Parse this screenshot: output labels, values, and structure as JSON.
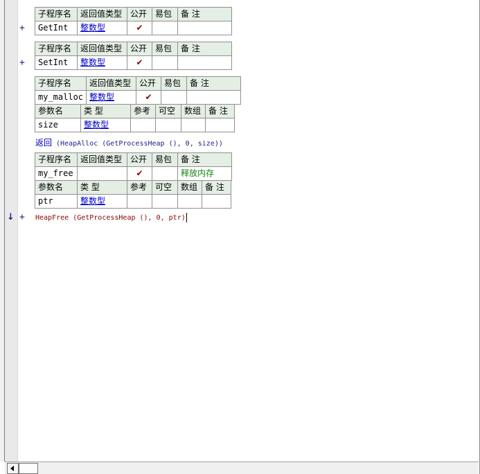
{
  "headers": {
    "proc": [
      "子程序名",
      "返回值类型",
      "公开",
      "易包",
      "备 注"
    ],
    "params": [
      "参数名",
      "类 型",
      "参考",
      "可空",
      "数组",
      "备 注"
    ]
  },
  "procedures": [
    {
      "name": "GetInt",
      "return_type": "整数型",
      "public": "✔",
      "easy_pkg": "",
      "note": ""
    },
    {
      "name": "SetInt",
      "return_type": "整数型",
      "public": "✔",
      "easy_pkg": "",
      "note": ""
    },
    {
      "name": "my_malloc",
      "return_type": "整数型",
      "public": "✔",
      "easy_pkg": "",
      "note": "",
      "params": [
        {
          "name": "size",
          "type": "整数型"
        }
      ]
    },
    {
      "name": "my_free",
      "return_type": "",
      "public": "✔",
      "easy_pkg": "",
      "note": "释放内存",
      "params": [
        {
          "name": "ptr",
          "type": "整数型"
        }
      ]
    }
  ],
  "code": {
    "malloc_return_kw": "返回",
    "malloc_body": " (HeapAlloc (GetProcessHeap (), 0, size))",
    "free_body": "HeapFree (GetProcessHeap (), 0, ptr)"
  },
  "gutter": {
    "expand_glyph": "+",
    "arrow_glyph": "↓"
  }
}
